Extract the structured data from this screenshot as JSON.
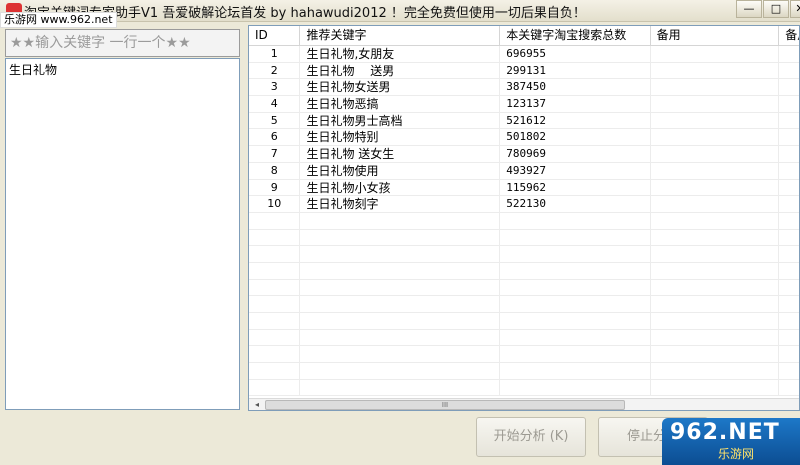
{
  "window": {
    "title": "淘宝关键词专家助手V1 吾爱破解论坛首发 by hahawudi2012 ！完全免费但使用一切后果自负！",
    "minimize": "—",
    "maximize": "□",
    "close": "✕"
  },
  "watermark": {
    "site": "乐游网 www.962.net",
    "logo_top": "962.NET",
    "logo_bottom": "乐游网"
  },
  "left_panel": {
    "header": "★★输入关键字 一行一个★★",
    "items": [
      "生日礼物"
    ]
  },
  "grid": {
    "columns": [
      "ID",
      "推荐关键字",
      "本关键字淘宝搜索总数",
      "备用",
      "备用"
    ],
    "rows": [
      {
        "id": "1",
        "keyword": "生日礼物,女朋友",
        "count": "696955",
        "b1": "",
        "b2": ""
      },
      {
        "id": "2",
        "keyword": "生日礼物　 送男",
        "count": "299131",
        "b1": "",
        "b2": ""
      },
      {
        "id": "3",
        "keyword": "生日礼物女送男",
        "count": "387450",
        "b1": "",
        "b2": ""
      },
      {
        "id": "4",
        "keyword": "生日礼物恶搞",
        "count": "123137",
        "b1": "",
        "b2": ""
      },
      {
        "id": "5",
        "keyword": "生日礼物男士高档",
        "count": "521612",
        "b1": "",
        "b2": ""
      },
      {
        "id": "6",
        "keyword": "生日礼物特别",
        "count": "501802",
        "b1": "",
        "b2": ""
      },
      {
        "id": "7",
        "keyword": "生日礼物 送女生",
        "count": "780969",
        "b1": "",
        "b2": ""
      },
      {
        "id": "8",
        "keyword": "生日礼物使用",
        "count": "493927",
        "b1": "",
        "b2": ""
      },
      {
        "id": "9",
        "keyword": "生日礼物小女孩",
        "count": "115962",
        "b1": "",
        "b2": ""
      },
      {
        "id": "10",
        "keyword": "生日礼物刻字",
        "count": "522130",
        "b1": "",
        "b2": ""
      }
    ],
    "scroll_left": "◂",
    "scroll_thumb": "III"
  },
  "buttons": {
    "start": "开始分析 (K)",
    "stop": "停止分析"
  }
}
